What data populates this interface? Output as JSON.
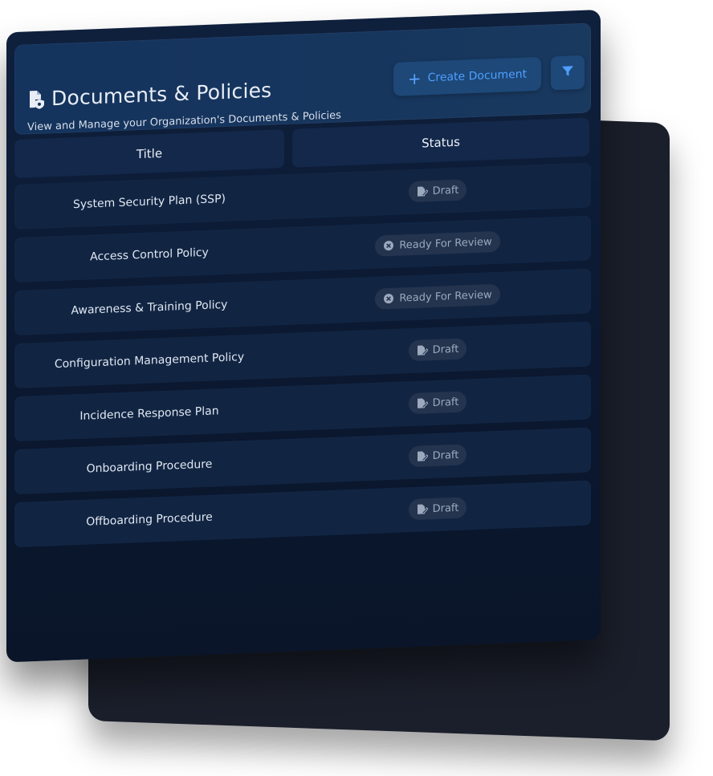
{
  "header": {
    "title": "Documents & Policies",
    "subtitle": "View and Manage your Organization's Documents & Policies",
    "create_label": "Create Document",
    "accent_color": "#4f9fff"
  },
  "table": {
    "columns": [
      "Title",
      "Status"
    ],
    "rows": [
      {
        "title": "System Security Plan (SSP)",
        "status": "Draft",
        "status_icon": "pen-document-icon"
      },
      {
        "title": "Access Control Policy",
        "status": "Ready For Review",
        "status_icon": "x-circle-icon"
      },
      {
        "title": "Awareness & Training Policy",
        "status": "Ready For Review",
        "status_icon": "x-circle-icon"
      },
      {
        "title": "Configuration Management Policy",
        "status": "Draft",
        "status_icon": "pen-document-icon"
      },
      {
        "title": "Incidence Response Plan",
        "status": "Draft",
        "status_icon": "pen-document-icon"
      },
      {
        "title": "Onboarding Procedure",
        "status": "Draft",
        "status_icon": "pen-document-icon"
      },
      {
        "title": "Offboarding Procedure",
        "status": "Draft",
        "status_icon": "pen-document-icon"
      }
    ]
  },
  "icons": {
    "title_icon": "document-shield-icon",
    "create_icon": "plus-icon",
    "filter_icon": "filter-icon"
  }
}
